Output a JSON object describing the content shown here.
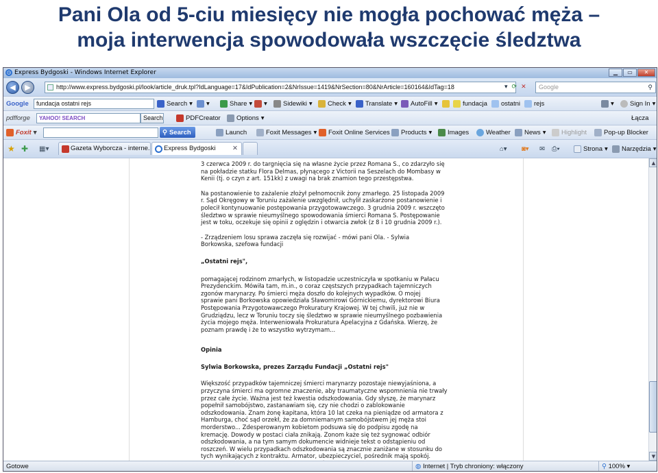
{
  "slide": {
    "title_line1": "Pani Ola od 5-ciu miesięcy nie mogła pochować męża –",
    "title_line2": "moja interwencja spowodowała wszczęcie śledztwa"
  },
  "window": {
    "title": "Express Bydgoski - Windows Internet Explorer"
  },
  "address_bar": {
    "url": "http://www.express.bydgoski.pl/look/article_druk.tpl?IdLanguage=17&IdPublication=2&NrIssue=1419&NrSection=80&NrArticle=160164&IdTag=18",
    "search_placeholder": "Google"
  },
  "google_toolbar": {
    "logo": "Google",
    "query": "fundacja ostatni rejs",
    "search_label": "Search",
    "share_label": "Share",
    "sidewiki_label": "Sidewiki",
    "check_label": "Check",
    "translate_label": "Translate",
    "autofill_label": "AutoFill",
    "chip1": "fundacja",
    "chip2": "ostatni",
    "chip3": "rejs",
    "signin_label": "Sign In"
  },
  "pdfforge_toolbar": {
    "logo": "pdfforge",
    "yahoo_search": "SEARCH",
    "search_label": "Search",
    "pdfcreator_label": "PDFCreator",
    "options_label": "Options",
    "links_label": "Łącza"
  },
  "foxit_toolbar": {
    "logo": "Foxit",
    "search_label": "Search",
    "launch_label": "Launch",
    "messages_label": "Foxit Messages",
    "services_label": "Foxit Online Services",
    "products_label": "Products",
    "images_label": "Images",
    "weather_label": "Weather",
    "news_label": "News",
    "highlight_label": "Highlight",
    "popup_label": "Pop-up Blocker"
  },
  "tabs": [
    {
      "label": "Gazeta Wyborcza - interne..."
    },
    {
      "label": "Express Bydgoski"
    }
  ],
  "command_bar": {
    "page_label": "Strona",
    "tools_label": "Narzędzia"
  },
  "article": {
    "paragraphs": [
      "3 czerwca 2009 r. do targnięcia się na własne życie przez Romana S., co zdarzyło się\nna pokładzie statku Flora Delmas, płynącego z Victorii na Seszelach do Mombasy w\nKenii (tj. o czyn z art. 151kk) z uwagi na brak znamion tego przestępstwa.",
      "Na postanowienie to zażalenie złożył pełnomocnik żony zmarłego. 25 listopada 2009\nr. Sąd Okręgowy w Toruniu zażalenie uwzględnił, uchylił zaskarżone postanowienie i\npolecił kontynuowanie postępowania przygotowawczego. 3 grudnia 2009 r. wszczęto\nśledztwo w sprawie nieumyślnego spowodowania śmierci Romana S. Postępowanie\njest w toku, oczekuje się opinii z oględzin i otwarcia zwłok (z 8 i 10 grudnia 2009 r.).",
      "- Zrządzeniem losu sprawa zaczęła się rozwijać - mówi pani Ola. - Sylwia\nBorkowska, szefowa fundacji",
      "„Ostatni rejs\",",
      "pomagającej rodzinom zmarłych, w listopadzie uczestniczyła w spotkaniu w Pałacu\nPrezydenckim. Mówiła tam, m.in., o coraz częstszych przypadkach tajemniczych\nzgonów marynarzy. Po śmierci męża doszło do kolejnych wypadków. O mojej\nsprawie pani Borkowska opowiedziała Sławomirowi Górnickiemu, dyrektorowi Biura\nPostępowania Przygotowawczego Prokuratury Krajowej. W tej chwili, już nie w\nGrudziądzu, lecz w Toruniu toczy się śledztwo w sprawie nieumyślnego pozbawienia\nżycia mojego męża. Interweniowała Prokuratura Apelacyjna z Gdańska. Wierzę, że\npoznam prawdę i że to wszystko wytrzymam...",
      "Opinia",
      "Sylwia Borkowska, prezes Zarządu Fundacji „Ostatni rejs\"",
      "Większość przypadków tajemniczej śmierci marynarzy pozostaje niewyjaśniona, a\nprzyczyna śmierci ma ogromne znaczenie, aby traumatyczne wspomnienia nie trwały\nprzez całe życie. Ważna jest też kwestia odszkodowania. Gdy słyszę, że marynarz\npopełnił samobójstwo, zastanawiam się, czy nie chodzi o zablokowanie\nodszkodowania. Znam żonę kapitana, która 10 lat czeka na pieniądze od armatora z\nHamburga, choć sąd orzekł, że za domniemanym samobójstwem jej męża stoi\nmorderstwo... Zdesperowanym kobietom podsuwa się do podpisu zgodę na\nkremację. Dowody w postaci ciała znikają. Zonom każe się też sygnować odbiór\nodszkodowania, a na tym samym dokumencie widnieje tekst o odstąpieniu od\nroszczeń. W wielu przypadkach odszkodowania są znacznie zaniżane w stosunku do\ntych wynikających z kontraktu. Armator, ubezpieczyciel, pośrednik mają spokój.\nZony, matki, rodziny nie popełniajcie błędów, zwracajcie się do nas o poradę!\nInformacje są dostępne na stronie internetowej: www.ostatnirejs.pl"
    ]
  },
  "status_bar": {
    "left": "Gotowe",
    "zone": "Internet | Tryb chroniony: włączony",
    "zoom": "100%"
  },
  "colors": {
    "title": "#1f3a6e",
    "toolbar_bg": "#d8e3f2",
    "link_blue": "#2a6fd0"
  }
}
